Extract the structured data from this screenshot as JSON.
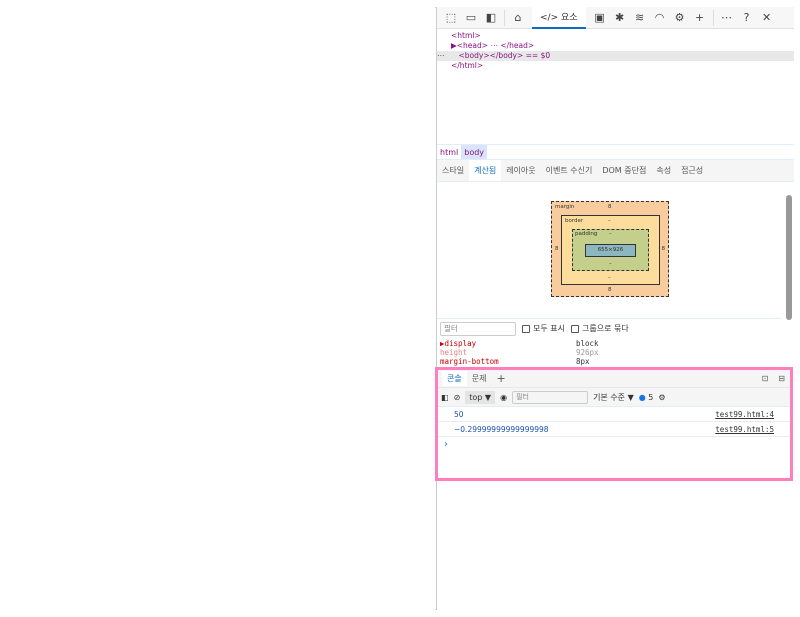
{
  "toolbar": {
    "elements_tab": "</> 요소"
  },
  "dom": {
    "lines": [
      "<html>",
      "▶<head> ⋯ </head>",
      "<body></body> == $0",
      "</html>"
    ],
    "ellipsis": "⋯"
  },
  "breadcrumb": [
    "html",
    "body"
  ],
  "subtabs": [
    "스타일",
    "계산됨",
    "레이아웃",
    "이벤트 수신기",
    "DOM 중단점",
    "속성",
    "접근성"
  ],
  "box_model": {
    "margin_label": "margin",
    "margin": "8",
    "border_label": "border",
    "border": "–",
    "padding_label": "padding",
    "padding": "–",
    "content": "655×926"
  },
  "computed": {
    "filter_placeholder": "필터",
    "show_all": "모두 표시",
    "group": "그룹으로 묶다",
    "props": [
      {
        "name": "▶display",
        "value": "block"
      },
      {
        "name": "height",
        "value": "926px"
      },
      {
        "name": "margin-bottom",
        "value": "8px"
      }
    ]
  },
  "console": {
    "tabs": [
      "콘솔",
      "문제"
    ],
    "context": "top ▼",
    "filter_placeholder": "필터",
    "level": "기본 수준 ▼",
    "count": "5",
    "messages": [
      {
        "text": "50",
        "source": "test99.html:4"
      },
      {
        "text": "−0.29999999999999998",
        "source": "test99.html:5"
      }
    ],
    "prompt": "›"
  }
}
